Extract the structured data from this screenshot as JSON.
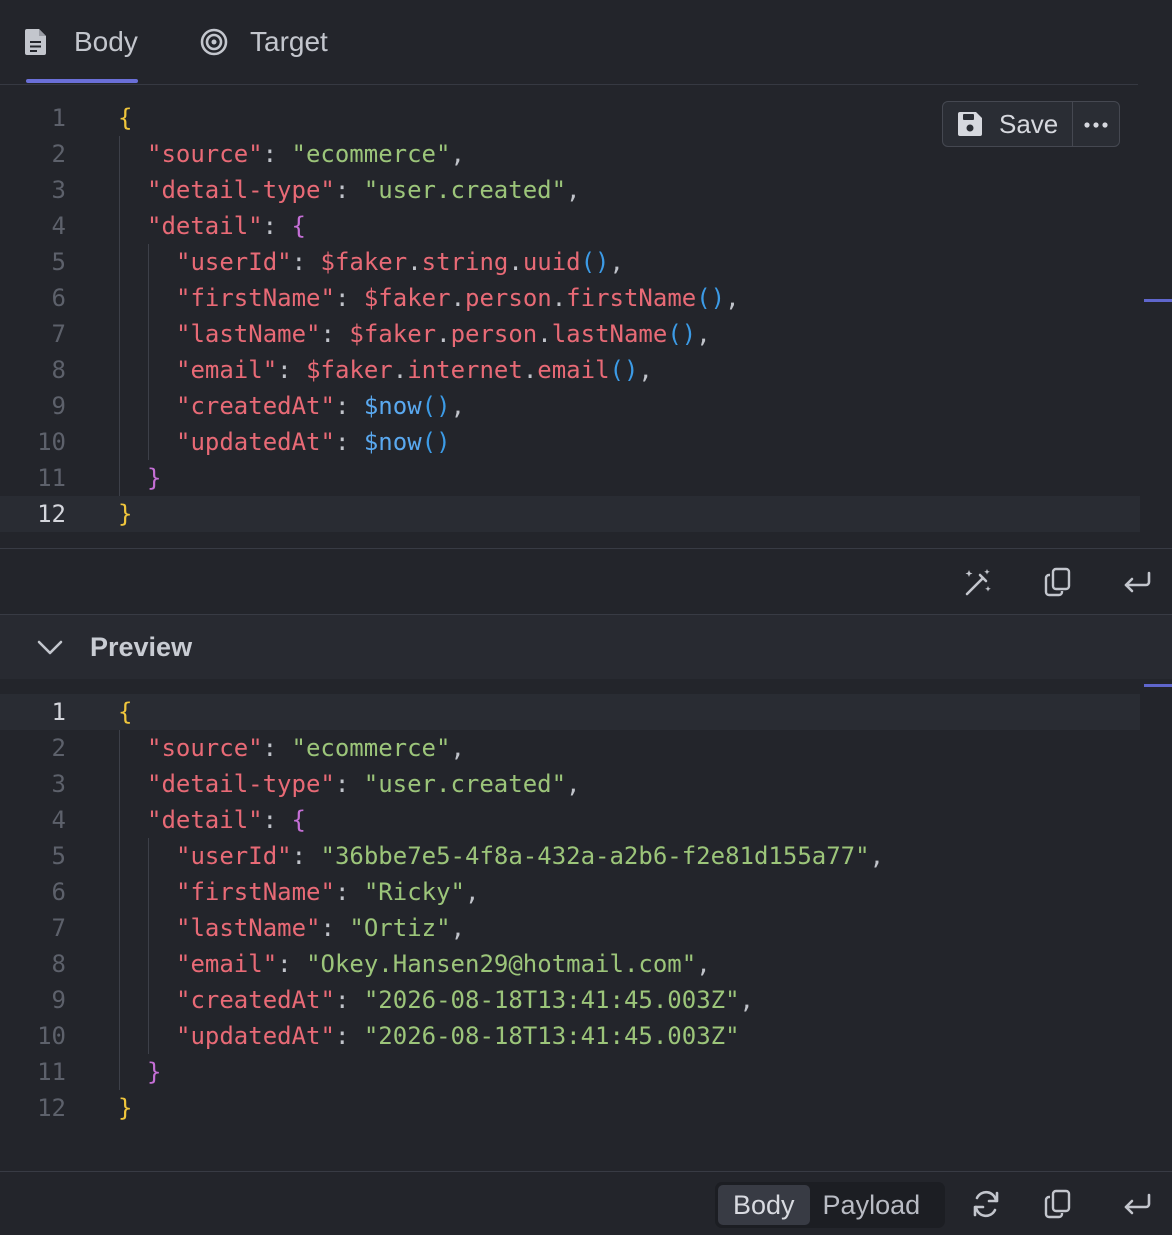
{
  "tabs": {
    "body": "Body",
    "target": "Target"
  },
  "toolbar": {
    "save": "Save"
  },
  "editor": {
    "lines": [
      [
        {
          "t": "{",
          "c": "br1"
        }
      ],
      [
        {
          "t": "\"source\"",
          "c": "key"
        },
        {
          "t": ": ",
          "c": "punc"
        },
        {
          "t": "\"ecommerce\"",
          "c": "str"
        },
        {
          "t": ",",
          "c": "punc"
        }
      ],
      [
        {
          "t": "\"detail-type\"",
          "c": "key"
        },
        {
          "t": ": ",
          "c": "punc"
        },
        {
          "t": "\"user.created\"",
          "c": "str"
        },
        {
          "t": ",",
          "c": "punc"
        }
      ],
      [
        {
          "t": "\"detail\"",
          "c": "key"
        },
        {
          "t": ": ",
          "c": "punc"
        },
        {
          "t": "{",
          "c": "br2"
        }
      ],
      [
        {
          "t": "\"userId\"",
          "c": "key"
        },
        {
          "t": ": ",
          "c": "punc"
        },
        {
          "t": "$faker",
          "c": "fn"
        },
        {
          "t": ".",
          "c": "punc"
        },
        {
          "t": "string",
          "c": "fn"
        },
        {
          "t": ".",
          "c": "punc"
        },
        {
          "t": "uuid",
          "c": "fn"
        },
        {
          "t": "()",
          "c": "paren"
        },
        {
          "t": ",",
          "c": "punc"
        }
      ],
      [
        {
          "t": "\"firstName\"",
          "c": "key"
        },
        {
          "t": ": ",
          "c": "punc"
        },
        {
          "t": "$faker",
          "c": "fn"
        },
        {
          "t": ".",
          "c": "punc"
        },
        {
          "t": "person",
          "c": "fn"
        },
        {
          "t": ".",
          "c": "punc"
        },
        {
          "t": "firstName",
          "c": "fn"
        },
        {
          "t": "()",
          "c": "paren"
        },
        {
          "t": ",",
          "c": "punc"
        }
      ],
      [
        {
          "t": "\"lastName\"",
          "c": "key"
        },
        {
          "t": ": ",
          "c": "punc"
        },
        {
          "t": "$faker",
          "c": "fn"
        },
        {
          "t": ".",
          "c": "punc"
        },
        {
          "t": "person",
          "c": "fn"
        },
        {
          "t": ".",
          "c": "punc"
        },
        {
          "t": "lastName",
          "c": "fn"
        },
        {
          "t": "()",
          "c": "paren"
        },
        {
          "t": ",",
          "c": "punc"
        }
      ],
      [
        {
          "t": "\"email\"",
          "c": "key"
        },
        {
          "t": ": ",
          "c": "punc"
        },
        {
          "t": "$faker",
          "c": "fn"
        },
        {
          "t": ".",
          "c": "punc"
        },
        {
          "t": "internet",
          "c": "fn"
        },
        {
          "t": ".",
          "c": "punc"
        },
        {
          "t": "email",
          "c": "fn"
        },
        {
          "t": "()",
          "c": "paren"
        },
        {
          "t": ",",
          "c": "punc"
        }
      ],
      [
        {
          "t": "\"createdAt\"",
          "c": "key"
        },
        {
          "t": ": ",
          "c": "punc"
        },
        {
          "t": "$now",
          "c": "now"
        },
        {
          "t": "()",
          "c": "paren"
        },
        {
          "t": ",",
          "c": "punc"
        }
      ],
      [
        {
          "t": "\"updatedAt\"",
          "c": "key"
        },
        {
          "t": ": ",
          "c": "punc"
        },
        {
          "t": "$now",
          "c": "now"
        },
        {
          "t": "()",
          "c": "paren"
        }
      ],
      [
        {
          "t": "}",
          "c": "br2"
        }
      ],
      [
        {
          "t": "}",
          "c": "br1"
        }
      ]
    ]
  },
  "preview": {
    "title": "Preview",
    "lines": [
      [
        {
          "t": "{",
          "c": "br1"
        }
      ],
      [
        {
          "t": "\"source\"",
          "c": "key"
        },
        {
          "t": ": ",
          "c": "punc"
        },
        {
          "t": "\"ecommerce\"",
          "c": "str"
        },
        {
          "t": ",",
          "c": "punc"
        }
      ],
      [
        {
          "t": "\"detail-type\"",
          "c": "key"
        },
        {
          "t": ": ",
          "c": "punc"
        },
        {
          "t": "\"user.created\"",
          "c": "str"
        },
        {
          "t": ",",
          "c": "punc"
        }
      ],
      [
        {
          "t": "\"detail\"",
          "c": "key"
        },
        {
          "t": ": ",
          "c": "punc"
        },
        {
          "t": "{",
          "c": "br2"
        }
      ],
      [
        {
          "t": "\"userId\"",
          "c": "key"
        },
        {
          "t": ": ",
          "c": "punc"
        },
        {
          "t": "\"36bbe7e5-4f8a-432a-a2b6-f2e81d155a77\"",
          "c": "str"
        },
        {
          "t": ",",
          "c": "punc"
        }
      ],
      [
        {
          "t": "\"firstName\"",
          "c": "key"
        },
        {
          "t": ": ",
          "c": "punc"
        },
        {
          "t": "\"Ricky\"",
          "c": "str"
        },
        {
          "t": ",",
          "c": "punc"
        }
      ],
      [
        {
          "t": "\"lastName\"",
          "c": "key"
        },
        {
          "t": ": ",
          "c": "punc"
        },
        {
          "t": "\"Ortiz\"",
          "c": "str"
        },
        {
          "t": ",",
          "c": "punc"
        }
      ],
      [
        {
          "t": "\"email\"",
          "c": "key"
        },
        {
          "t": ": ",
          "c": "punc"
        },
        {
          "t": "\"Okey.Hansen29@hotmail.com\"",
          "c": "str"
        },
        {
          "t": ",",
          "c": "punc"
        }
      ],
      [
        {
          "t": "\"createdAt\"",
          "c": "key"
        },
        {
          "t": ": ",
          "c": "punc"
        },
        {
          "t": "\"2026-08-18T13:41:45.003Z\"",
          "c": "str"
        },
        {
          "t": ",",
          "c": "punc"
        }
      ],
      [
        {
          "t": "\"updatedAt\"",
          "c": "key"
        },
        {
          "t": ": ",
          "c": "punc"
        },
        {
          "t": "\"2026-08-18T13:41:45.003Z\"",
          "c": "str"
        }
      ],
      [
        {
          "t": "}",
          "c": "br2"
        }
      ],
      [
        {
          "t": "}",
          "c": "br1"
        }
      ]
    ]
  },
  "bottom": {
    "seg_body": "Body",
    "seg_payload": "Payload"
  },
  "colors": {
    "accent": "#6a6fd8",
    "key": "#e86a76",
    "string": "#9cc57a",
    "brace1": "#f0c63c",
    "brace2": "#c56fd6",
    "paren": "#3c9be6"
  }
}
